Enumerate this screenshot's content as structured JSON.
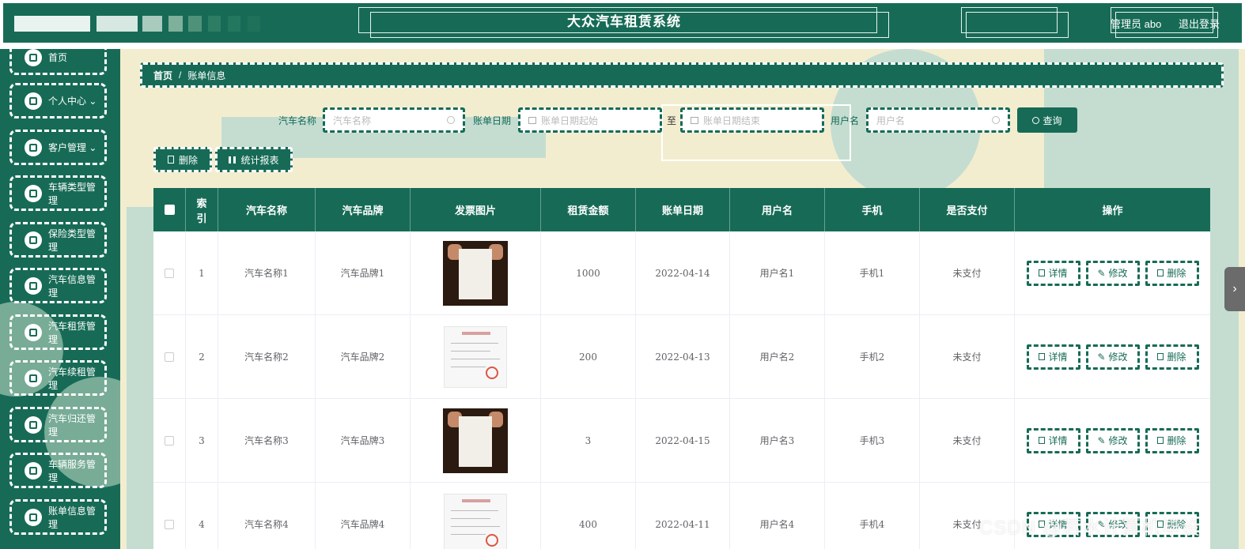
{
  "header": {
    "app_title": "大众汽车租赁系统",
    "user_label": "管理员 abo",
    "logout_label": "退出登录",
    "color": "#176b56"
  },
  "sidebar": {
    "items": [
      {
        "label": "首页",
        "icon": "home-icon"
      },
      {
        "label": "个人中心 ⌄",
        "icon": "user-icon"
      },
      {
        "label": "客户管理 ⌄",
        "icon": "grid-icon"
      },
      {
        "label": "车辆类型管理",
        "icon": "car-type-icon"
      },
      {
        "label": "保险类型管理",
        "icon": "insurance-icon"
      },
      {
        "label": "汽车信息管理",
        "icon": "car-info-icon"
      },
      {
        "label": "汽车租赁管理",
        "icon": "rental-icon"
      },
      {
        "label": "汽车续租管理",
        "icon": "renew-icon"
      },
      {
        "label": "汽车归还管理",
        "icon": "return-icon"
      },
      {
        "label": "车辆服务管理",
        "icon": "service-icon"
      },
      {
        "label": "账单信息管理",
        "icon": "bill-icon"
      }
    ]
  },
  "breadcrumb": {
    "home": "首页",
    "separator": "/",
    "current": "账单信息"
  },
  "search": {
    "car_name_label": "汽车名称",
    "car_name_placeholder": "汽车名称",
    "bill_date_label": "账单日期",
    "date_start_placeholder": "账单日期起始",
    "date_to": "至",
    "date_end_placeholder": "账单日期结束",
    "username_label": "用户名",
    "username_placeholder": "用户名",
    "search_button": "查询"
  },
  "actions": {
    "delete_label": "删除",
    "report_label": "统计报表"
  },
  "table": {
    "columns": [
      "索引",
      "汽车名称",
      "汽车品牌",
      "发票图片",
      "租赁金额",
      "账单日期",
      "用户名",
      "手机",
      "是否支付",
      "操作"
    ],
    "rows": [
      {
        "index": "1",
        "car_name": "汽车名称1",
        "brand": "汽车品牌1",
        "image": "photo",
        "amount": "1000",
        "date": "2022-04-14",
        "user": "用户名1",
        "phone": "手机1",
        "paid": "未支付"
      },
      {
        "index": "2",
        "car_name": "汽车名称2",
        "brand": "汽车品牌2",
        "image": "scan",
        "amount": "200",
        "date": "2022-04-13",
        "user": "用户名2",
        "phone": "手机2",
        "paid": "未支付"
      },
      {
        "index": "3",
        "car_name": "汽车名称3",
        "brand": "汽车品牌3",
        "image": "photo",
        "amount": "3",
        "date": "2022-04-15",
        "user": "用户名3",
        "phone": "手机3",
        "paid": "未支付"
      },
      {
        "index": "4",
        "car_name": "汽车名称4",
        "brand": "汽车品牌4",
        "image": "scan",
        "amount": "400",
        "date": "2022-04-11",
        "user": "用户名4",
        "phone": "手机4",
        "paid": "未支付"
      }
    ],
    "op_detail": "详情",
    "op_edit": "修改",
    "op_delete": "删除"
  },
  "watermark": "CSDN @若水计算机毕设"
}
